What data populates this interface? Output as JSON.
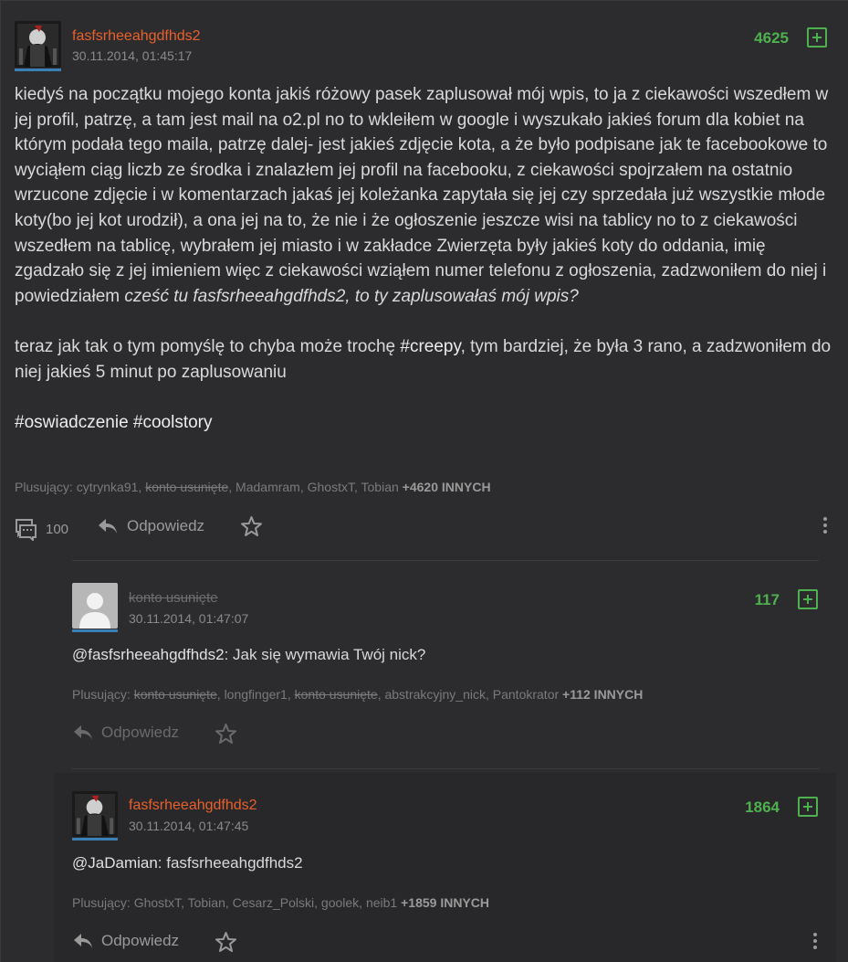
{
  "post": {
    "author": "fasfsrheeahgdfhds2",
    "date": "30.11.2014, 01:45:17",
    "votes": "4625",
    "paragraph1_main": "kiedyś na początku mojego konta jakiś różowy pasek zaplusował mój wpis, to ja z ciekawości wszedłem w jej profil, patrzę, a tam jest mail na o2.pl no to wkleiłem w google i wyszukało jakieś forum dla kobiet na którym podała tego maila, patrzę dalej- jest jakieś zdjęcie kota, a że było podpisane jak te facebookowe to wyciąłem ciąg liczb ze środka i znalazłem jej profil na facebooku, z ciekawości spojrzałem na ostatnio wrzucone zdjęcie i w komentarzach jakaś jej koleżanka zapytała się jej czy sprzedała już wszystkie młode koty(bo jej kot urodził), a ona jej na to, że nie i że ogłoszenie jeszcze wisi na tablicy no to z ciekawości wszedłem na tablicę, wybrałem jej miasto i w zakładce Zwierzęta były jakieś koty do oddania, imię zgadzało się z jej imieniem więc z ciekawości wziąłem numer telefonu z ogłoszenia, zadzwoniłem do niej i powiedziałem ",
    "paragraph1_italic": "cześć tu fasfsrheeahgdfhds2, to ty zaplusowałaś mój wpis?",
    "paragraph2_before": "teraz jak tak o tym pomyślę to chyba może trochę ",
    "paragraph2_tag": "#creepy",
    "paragraph2_after": ", tym bardziej, że była 3 rano, a zadzwoniłem do niej jakieś 5 minut po zaplusowaniu",
    "tags_line": "#oswiadczenie #coolstory",
    "plusers_label": "Plusujący:",
    "plusers": [
      {
        "name": "cytrynka91",
        "deleted": false
      },
      {
        "name": "konto usunięte",
        "deleted": true
      },
      {
        "name": "Madamram",
        "deleted": false
      },
      {
        "name": "GhostxT",
        "deleted": false
      },
      {
        "name": "Tobian",
        "deleted": false
      }
    ],
    "plusers_more": "+4620 INNYCH",
    "comments_count": "100",
    "reply_label": "Odpowiedz"
  },
  "comments": [
    {
      "author": "konto usunięte",
      "author_deleted": true,
      "date": "30.11.2014, 01:47:07",
      "votes": "117",
      "mention": "@fasfsrheeahgdfhds2",
      "text": ": Jak się wymawia Twój nick?",
      "plusers_label": "Plusujący:",
      "plusers": [
        {
          "name": "konto usunięte",
          "deleted": true
        },
        {
          "name": "longfinger1",
          "deleted": false
        },
        {
          "name": "konto usunięte",
          "deleted": true
        },
        {
          "name": "abstrakcyjny_nick",
          "deleted": false
        },
        {
          "name": "Pantokrator",
          "deleted": false
        }
      ],
      "plusers_more": "+112 INNYCH",
      "reply_label": "Odpowiedz"
    },
    {
      "author": "fasfsrheeahgdfhds2",
      "author_deleted": false,
      "date": "30.11.2014, 01:47:45",
      "votes": "1864",
      "mention": "@JaDamian",
      "text": ": fasfsrheeahgdfhds2",
      "plusers_label": "Plusujący:",
      "plusers": [
        {
          "name": "GhostxT",
          "deleted": false
        },
        {
          "name": "Tobian",
          "deleted": false
        },
        {
          "name": "Cesarz_Polski",
          "deleted": false
        },
        {
          "name": "goolek",
          "deleted": false
        },
        {
          "name": "neib1",
          "deleted": false
        }
      ],
      "plusers_more": "+1859 INNYCH",
      "reply_label": "Odpowiedz"
    }
  ],
  "colors": {
    "background": "#2c2c2e",
    "author_orange": "#e8602c",
    "vote_green": "#4fb04f",
    "avatar_underline_blue": "#3a7fb5"
  }
}
